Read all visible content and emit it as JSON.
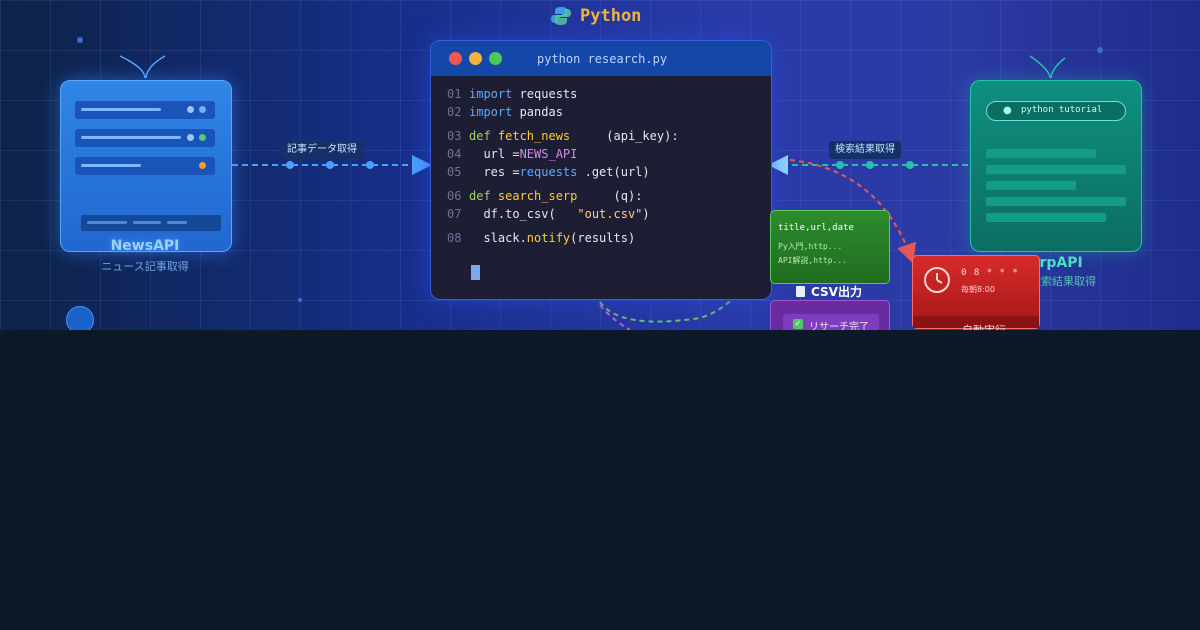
{
  "brand": {
    "name": "Python",
    "icon": "python-logo-icon",
    "color": "#f3b33d"
  },
  "newsapi": {
    "title": "NewsAPI",
    "subtitle": "ニュース記事取得"
  },
  "serpapi": {
    "title": "SerpAPI",
    "title_visible": "erpAPI",
    "subtitle_visible": "検索結果取得",
    "search_query": "python tutorial"
  },
  "editor": {
    "filename": "python research.py",
    "lines": [
      {
        "n": "01",
        "parts": [
          [
            "kw",
            "import"
          ],
          [
            "",
            " requests"
          ]
        ]
      },
      {
        "n": "02",
        "parts": [
          [
            "kw",
            "import"
          ],
          [
            "",
            " pandas"
          ]
        ]
      },
      {
        "n": "03",
        "parts": [
          [
            "kw2",
            "def"
          ],
          [
            "fn",
            " fetch_news"
          ],
          [
            "",
            "     (api_key):"
          ]
        ]
      },
      {
        "n": "04",
        "parts": [
          [
            "",
            "  url ="
          ],
          [
            "const",
            "NEWS_API"
          ]
        ]
      },
      {
        "n": "05",
        "parts": [
          [
            "",
            "  res ="
          ],
          [
            "kw",
            "requests"
          ],
          [
            "",
            " .get(url)"
          ]
        ]
      },
      {
        "n": "06",
        "parts": [
          [
            "kw2",
            "def"
          ],
          [
            "fn",
            " search_serp"
          ],
          [
            "",
            "     (q):"
          ]
        ]
      },
      {
        "n": "07",
        "parts": [
          [
            "",
            "  df.to_csv(   "
          ],
          [
            "str",
            "\"out.csv\""
          ],
          [
            "",
            ")"
          ]
        ]
      },
      {
        "n": "08",
        "parts": [
          [
            "",
            "  slack."
          ],
          [
            "fn",
            "notify"
          ],
          [
            "",
            "(results)"
          ]
        ]
      }
    ]
  },
  "arrows": {
    "news_label": "記事データ取得",
    "serp_label": "検索結果取得"
  },
  "csv": {
    "header": "title,url,date",
    "rows": [
      "Py入門,http...",
      "API解説,http..."
    ],
    "label": "CSV出力"
  },
  "slack": {
    "message": "リサーチ完了"
  },
  "schedule": {
    "cron": "0 8 * * *",
    "desc": "毎朝8:00",
    "label_partial": "自動実行"
  },
  "colors": {
    "accent": "#3d8cff",
    "news": "#2f86e6",
    "serp": "#0f8f80",
    "csv": "#2e8c2e",
    "slack": "#6a2aa0",
    "schedule": "#d82a2a"
  }
}
